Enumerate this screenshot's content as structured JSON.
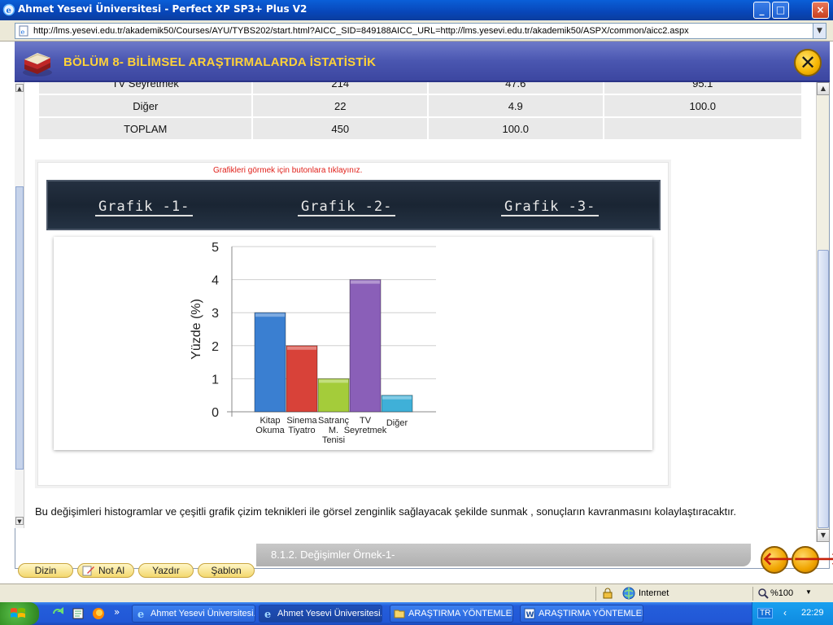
{
  "window": {
    "title": "Ahmet Yesevi Üniversitesi - Perfect XP SP3+ Plus V2",
    "address": "http://lms.yesevi.edu.tr/akademik50/Courses/AYU/TYBS202/start.html?AICC_SID=849188AICC_URL=http://lms.yesevi.edu.tr/akademik50/ASPX/common/aicc2.aspx"
  },
  "header": {
    "title": "BÖLÜM 8- BİLİMSEL ARAŞTIRMALARDA İSTATİSTİK"
  },
  "table": {
    "rows": [
      [
        "TV Seyretmek",
        "214",
        "47.6",
        "95.1"
      ],
      [
        "Diğer",
        "22",
        "4.9",
        "100.0"
      ],
      [
        "TOPLAM",
        "450",
        "100.0",
        ""
      ]
    ]
  },
  "chart_section": {
    "hint": "Grafikleri görmek için butonlara tıklayınız.",
    "buttons": [
      "Grafik -1-",
      "Grafik -2-",
      "Grafik -3-"
    ]
  },
  "chart_data": {
    "type": "bar",
    "categories": [
      "Kitap Okuma",
      "Sinema Tiyatro",
      "Satranç M. Tenisi",
      "TV Seyretmek",
      "Diğer"
    ],
    "category_lines": [
      [
        "Kitap",
        "Okuma"
      ],
      [
        "Sinema",
        "Tiyatro"
      ],
      [
        "Satranç",
        "M.",
        "Tenisi"
      ],
      [
        "TV",
        "Seyretmek"
      ],
      [
        "Diğer"
      ]
    ],
    "values": [
      3,
      2,
      1,
      4,
      0.5
    ],
    "colors": [
      "#3a7fd1",
      "#d84239",
      "#a4cc3a",
      "#8a5fb8",
      "#3fb0d8"
    ],
    "ylabel": "Yüzde (%)",
    "yticks": [
      "0",
      "1",
      "2",
      "3",
      "4",
      "5"
    ],
    "ylim": [
      0,
      5
    ],
    "grid": true
  },
  "paragraph": "Bu değişimleri histogramlar ve çeşitli grafik çizim teknikleri ile görsel zenginlik sağlayacak şekilde sunmak , sonuçların kavranmasını kolaylaştıracaktır.",
  "footer": {
    "page_label": "8.1.2. Değişimler Örnek-1-",
    "buttons": [
      "Dizin",
      "Not Al",
      "Yazdır",
      "Şablon"
    ]
  },
  "statusbar": {
    "zone": "Internet",
    "zoom": "%100"
  },
  "taskbar": {
    "items": [
      "Ahmet Yesevi Üniversitesi...",
      "Ahmet Yesevi Üniversitesi...",
      "ARAŞTIRMA YÖNTEMLERİ...",
      "ARAŞTIRMA YÖNTEMLERİ..."
    ],
    "lang": "TR",
    "clock": "22:29"
  }
}
